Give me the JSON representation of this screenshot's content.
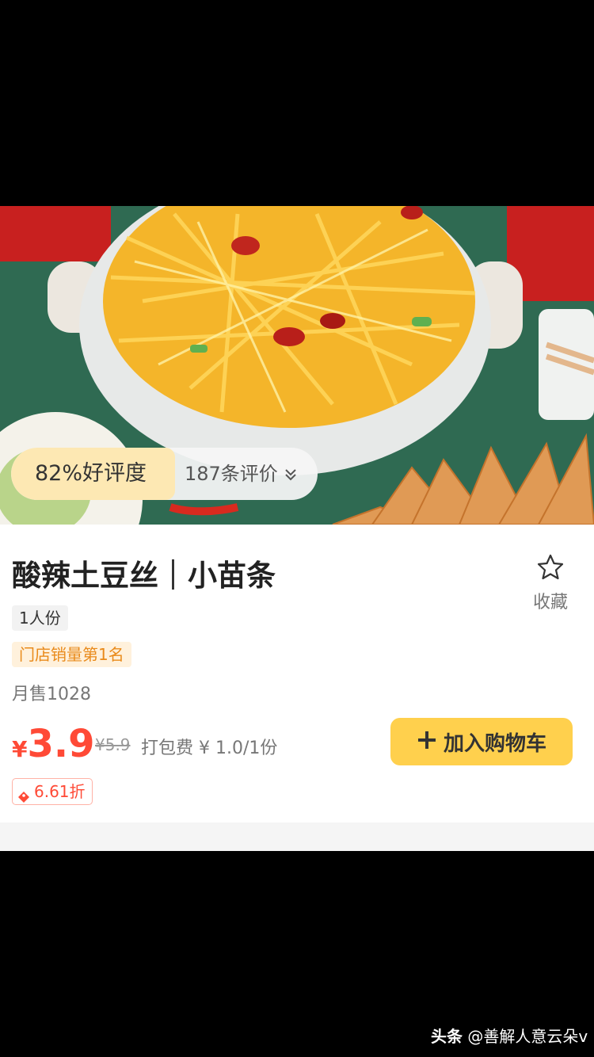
{
  "product": {
    "rating": "82%好评度",
    "reviews": "187条评价",
    "title": "酸辣土豆丝｜小苗条",
    "favorite_label": "收藏",
    "serving": "1人份",
    "rank_tag": "门店销量第1名",
    "monthly_sales": "月售1028",
    "price_currency": "¥",
    "price_value": "3.9",
    "original_price": "¥5.9",
    "packing_fee": "打包费 ¥ 1.0/1份",
    "add_to_cart_label": "加入购物车",
    "discount": "6.61折"
  },
  "watermark": {
    "platform": "头条",
    "author": "@善解人意云朵v"
  },
  "colors": {
    "accent_price": "#ff4a36",
    "cart_button": "#ffd04d",
    "rank_tag_text": "#e98a1a"
  }
}
